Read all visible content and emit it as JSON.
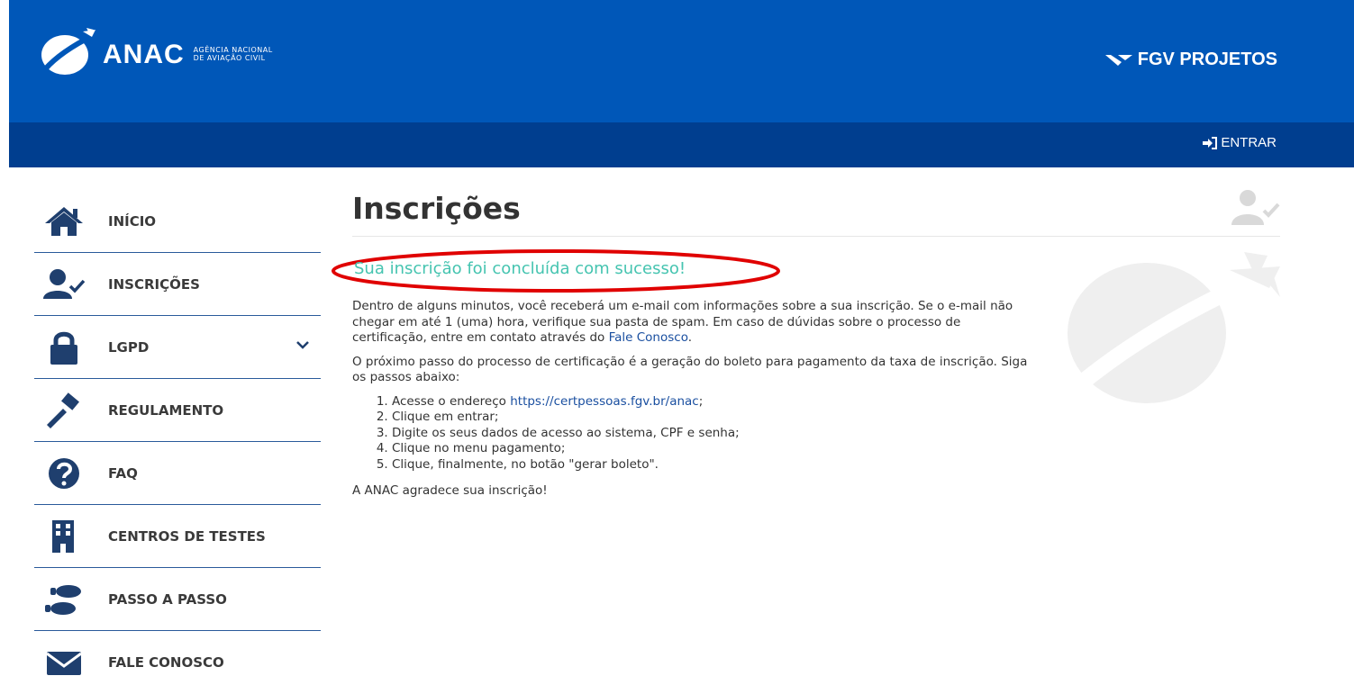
{
  "header": {
    "logo_name": "ANAC",
    "logo_sub_line1": "AGÊNCIA NACIONAL",
    "logo_sub_line2": "DE AVIAÇÃO CIVIL",
    "partner": "FGV PROJETOS",
    "login_label": "ENTRAR"
  },
  "sidebar": {
    "items": [
      {
        "label": "INÍCIO",
        "icon": "home-icon"
      },
      {
        "label": "INSCRIÇÕES",
        "icon": "user-check-icon"
      },
      {
        "label": "LGPD",
        "icon": "lock-icon"
      },
      {
        "label": "REGULAMENTO",
        "icon": "gavel-icon"
      },
      {
        "label": "FAQ",
        "icon": "question-icon"
      },
      {
        "label": "CENTROS DE TESTES",
        "icon": "building-icon"
      },
      {
        "label": "PASSO A PASSO",
        "icon": "footprints-icon"
      },
      {
        "label": "FALE CONOSCO",
        "icon": "envelope-icon"
      }
    ]
  },
  "main": {
    "title": "Inscrições",
    "success_message": "Sua inscrição foi concluída com sucesso!",
    "paragraph1_text": "Dentro de alguns minutos, você receberá um e-mail com informações sobre a sua inscrição. Se o e-mail não chegar em até 1 (uma) hora, verifique sua pasta de spam. Em caso de dúvidas sobre o processo de certificação, entre em contato através do ",
    "paragraph1_link": "Fale Conosco",
    "paragraph1_end": ".",
    "paragraph2": "O próximo passo do processo de certificação é a geração do boleto para pagamento da taxa de inscrição. Siga os passos abaixo:",
    "step1_text": "Acesse o endereço ",
    "step1_link": "https://certpessoas.fgv.br/anac",
    "step1_end": ";",
    "step2": "Clique em entrar;",
    "step3": "Digite os seus dados de acesso ao sistema, CPF e senha;",
    "step4": "Clique no menu pagamento;",
    "step5": "Clique, finalmente, no botão \"gerar boleto\".",
    "thanks": "A ANAC agradece sua inscrição!"
  },
  "colors": {
    "header_top": "#0057b8",
    "header_bottom": "#003e8f",
    "success": "#45c4b0",
    "highlight_ellipse": "#e00000",
    "link": "#1a4fa0"
  }
}
